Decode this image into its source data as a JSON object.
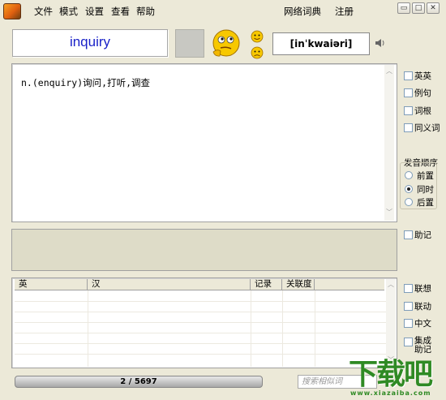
{
  "menu": [
    "文件",
    "模式",
    "设置",
    "查看",
    "帮助"
  ],
  "menu_right": [
    "网络词典",
    "注册"
  ],
  "window_buttons": [
    "▭",
    "□",
    "✕"
  ],
  "word": "inquiry",
  "phonetic": "[inˈkwaiəri]",
  "definition": "n.(enquiry)询问,打听,调查",
  "options": [
    "英英",
    "例句",
    "词根",
    "同义词"
  ],
  "pron_group": {
    "title": "发音顺序",
    "items": [
      {
        "label": "前置",
        "selected": false
      },
      {
        "label": "同时",
        "selected": true
      },
      {
        "label": "后置",
        "selected": false
      }
    ]
  },
  "memo_checkbox": "助记",
  "table": {
    "columns": [
      "英",
      "汉",
      "记录",
      "关联度"
    ]
  },
  "list_options": [
    "联想",
    "联动",
    "中文"
  ],
  "list_option_multi": [
    "集成",
    "助记"
  ],
  "progress": {
    "text": "2 / 5697",
    "current": 2,
    "total": 5697
  },
  "search_placeholder": "搜索相似词",
  "watermark": {
    "main": "下载吧",
    "sub": "www.xiazaiba.com"
  }
}
